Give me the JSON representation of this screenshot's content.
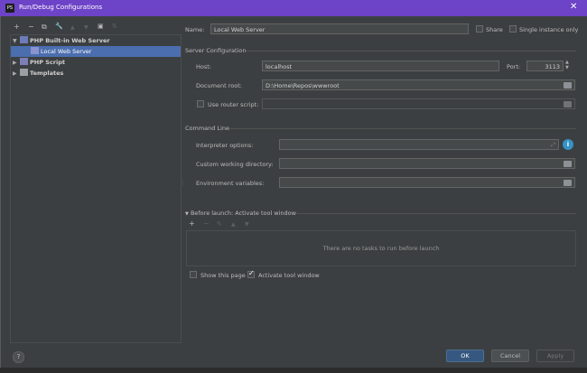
{
  "window": {
    "title": "Run/Debug Configurations",
    "app_icon": "PS",
    "close_glyph": "✕"
  },
  "toolbar": {
    "add": "+",
    "remove": "−",
    "copy": "⧉",
    "edit": "🔧",
    "up": "▲",
    "down": "▼",
    "folder": "▣",
    "sort": "⇅"
  },
  "tree": {
    "php_builtin": "PHP Built-in Web Server",
    "local_web_server": "Local Web Server",
    "php_script": "PHP Script",
    "templates": "Templates"
  },
  "name": {
    "label": "Name:",
    "value": "Local Web Server"
  },
  "share": {
    "label": "Share"
  },
  "single_instance": {
    "label": "Single instance only"
  },
  "server_config": {
    "section": "Server Configuration",
    "host_label": "Host:",
    "host_value": "localhost",
    "port_label": "Port:",
    "port_value": "3113",
    "docroot_label": "Document root:",
    "docroot_value": "D:\\Home\\Repos\\wwwroot",
    "router_label": "Use router script:"
  },
  "command_line": {
    "section": "Command Line",
    "interp_label": "Interpreter options:",
    "cwd_label": "Custom working directory:",
    "env_label": "Environment variables:",
    "info_glyph": "i"
  },
  "before_launch": {
    "label": "Before launch: Activate tool window",
    "empty_text": "There are no tasks to run before launch",
    "add": "+",
    "remove": "−",
    "edit": "✎",
    "up": "▲",
    "down": "▼"
  },
  "options": {
    "show_page": "Show this page",
    "activate_tool": "Activate tool window"
  },
  "footer": {
    "help": "?",
    "ok": "OK",
    "cancel": "Cancel",
    "apply": "Apply"
  },
  "colors": {
    "title_bar": "#6d43c7",
    "selection": "#4b6eaf",
    "ok_button": "#365880",
    "dialog_bg": "#3c3f41"
  }
}
